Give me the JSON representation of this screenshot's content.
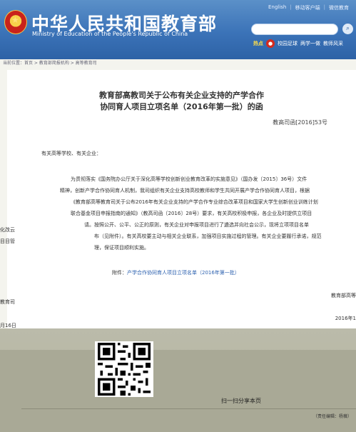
{
  "header": {
    "site_title": "中华人民共和国教育部",
    "site_subtitle": "Ministry of Education of the People's Republic of China",
    "top_links": [
      "English",
      "移动客户端",
      "微信教育"
    ],
    "quick_links": {
      "hot": "热点",
      "badge": "校园足球",
      "link1": "两学一做",
      "link2": "教师风采"
    }
  },
  "breadcrumb": "当前位置：首页 > 教育部简报机构 > 高等教育司",
  "document": {
    "title_line1": "教育部高教司关于公布有关企业支持的产学合作",
    "title_line2": "协同育人项目立项名单（2016年第一批）的函",
    "doc_number": "教高司函[2016]53号",
    "salutation": "有关高等学校、有关企业：",
    "p1_l1": "为贯彻落实《国务院办公厅关于深化高等学校创新创业教育改革的实施意见》（国办发〔2015〕36号）文件",
    "p1_l2": "精神，创新产学合作协同育人机制，我司组织有关企业支持高校教师和学生共同开展产学合作协同育人项目，根据",
    "p1_l3": "《教育部高等教育司关于公布2016年有关企业支持的产学合作专业综合改革项目和国家大学生创新创业训练计划",
    "p1_l4": "联合基金项目申报指南的通知》（教高司函〔2016〕28号）要求，有关高校积极申报，各企业及时提供立项目",
    "p2_l1": "请。按照公开、公平、公正的原则，有关企业对申报项目进行了遴选并向社会公示，现将立项项目名单",
    "p2_l2": "布（见附件）。有关高校要主动与相关企业联系，加强项目实施过程的管理。有关企业要履行承诺，规范",
    "p2_l3": "理，保证项目顺利实施。",
    "attachment_prefix": "附件：",
    "attachment_link": "产学合作协同育人项目立项名单（2016年第一批）",
    "signature": "教育部高等",
    "date_partial": "2016年1",
    "left_frag1": "化改云",
    "left_frag2": "目目管",
    "left_frag3": "教育司",
    "left_frag4": "月16日"
  },
  "qr": {
    "caption": "扫一扫分享本页"
  },
  "footer": {
    "editor": "（责任编辑：杨薇）"
  }
}
